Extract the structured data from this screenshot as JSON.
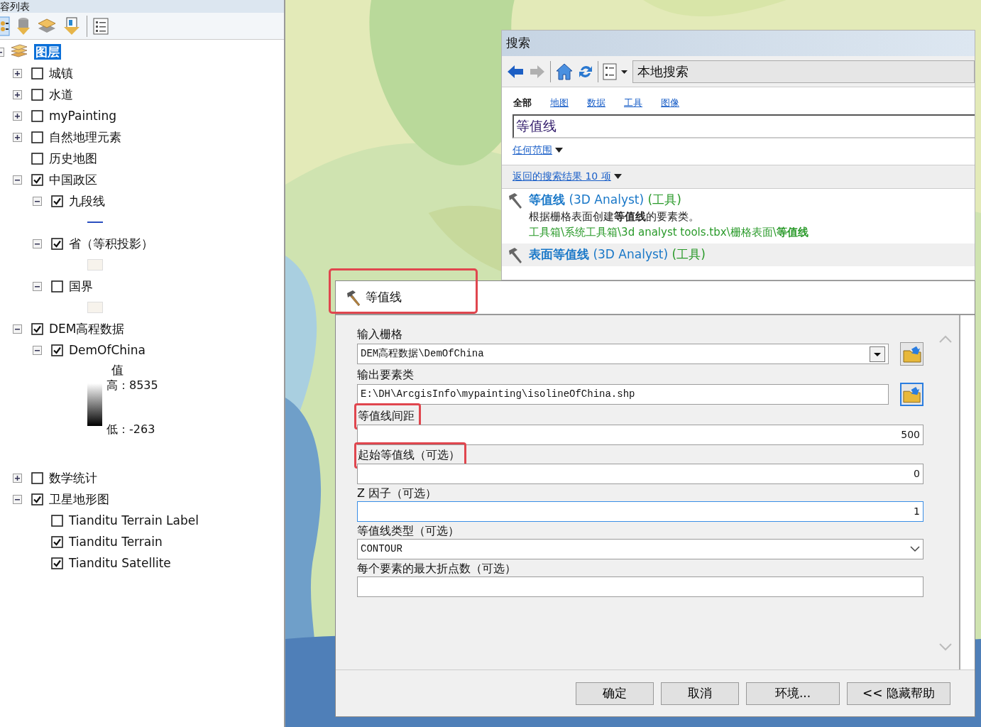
{
  "toc": {
    "title": "容列表",
    "root": {
      "label": "图层",
      "selected": true,
      "expanded": true,
      "children": [
        {
          "label": "城镇",
          "checked": false,
          "expanded": false
        },
        {
          "label": "水道",
          "checked": false,
          "expanded": false
        },
        {
          "label": "myPainting",
          "checked": false,
          "expanded": false
        },
        {
          "label": "自然地理元素",
          "checked": false,
          "expanded": false
        },
        {
          "label": "历史地图",
          "checked": false
        },
        {
          "label": "中国政区",
          "checked": true,
          "expanded": true,
          "children": [
            {
              "label": "九段线",
              "checked": true,
              "expanded": true,
              "legend": {
                "kind": "line"
              }
            },
            {
              "label": "省（等积投影）",
              "checked": true,
              "expanded": true,
              "legend": {
                "kind": "patch"
              }
            },
            {
              "label": "国界",
              "checked": false,
              "expanded": true,
              "legend": {
                "kind": "patch"
              }
            }
          ]
        },
        {
          "label": "DEM高程数据",
          "checked": true,
          "expanded": true,
          "children": [
            {
              "label": "DemOfChina",
              "checked": true,
              "expanded": true,
              "legend": {
                "kind": "ramp",
                "title": "值",
                "high": "高：8535",
                "low": "低：-263"
              }
            }
          ]
        },
        {
          "label": "数学统计",
          "checked": false,
          "expanded": false
        },
        {
          "label": "卫星地形图",
          "checked": true,
          "expanded": true,
          "children": [
            {
              "label": "Tianditu Terrain Label",
              "checked": false
            },
            {
              "label": "Tianditu Terrain",
              "checked": true
            },
            {
              "label": "Tianditu Satellite",
              "checked": true
            }
          ]
        }
      ]
    }
  },
  "search": {
    "title": "搜索",
    "location": "本地搜索",
    "tabs": [
      {
        "label": "全部",
        "selected": true
      },
      {
        "label": "地图",
        "selected": false
      },
      {
        "label": "数据",
        "selected": false
      },
      {
        "label": "工具",
        "selected": false
      },
      {
        "label": "图像",
        "selected": false
      }
    ],
    "query": "等值线",
    "scope": "任何范围",
    "result_count": "返回的搜索结果 10 项",
    "results": [
      {
        "name": "等值线",
        "source": "(3D Analyst)",
        "type": "(工具)",
        "description": "根据栅格表面创建**等值线**的要素类。",
        "path": "工具箱\\系统工具箱\\3d analyst tools.tbx\\栅格表面\\**等值线**"
      },
      {
        "name": "表面等值线",
        "source": "(3D Analyst)",
        "type": "(工具)"
      }
    ]
  },
  "dialog": {
    "title": "等值线",
    "highlighted": true,
    "params": [
      {
        "label": "输入栅格",
        "kind": "dropdown-browse",
        "value": "DEM高程数据\\DemOfChina",
        "highlighted": false
      },
      {
        "label": "输出要素类",
        "kind": "text-browse",
        "value": "E:\\DH\\ArcgisInfo\\mypainting\\isolineOfChina.shp",
        "highlighted": false
      },
      {
        "label": "等值线间距",
        "kind": "number",
        "value": "500",
        "highlighted": true
      },
      {
        "label": "起始等值线（可选）",
        "kind": "number",
        "value": "0",
        "highlighted": true
      },
      {
        "label": "Z 因子（可选）",
        "kind": "number",
        "value": "1",
        "focused": true,
        "highlighted": false
      },
      {
        "label": "等值线类型（可选）",
        "kind": "select",
        "value": "CONTOUR",
        "highlighted": false
      },
      {
        "label": "每个要素的最大折点数（可选）",
        "kind": "text",
        "highlighted": false
      }
    ],
    "buttons": [
      "确定",
      "取消",
      "环境...",
      "<< 隐藏帮助"
    ]
  }
}
